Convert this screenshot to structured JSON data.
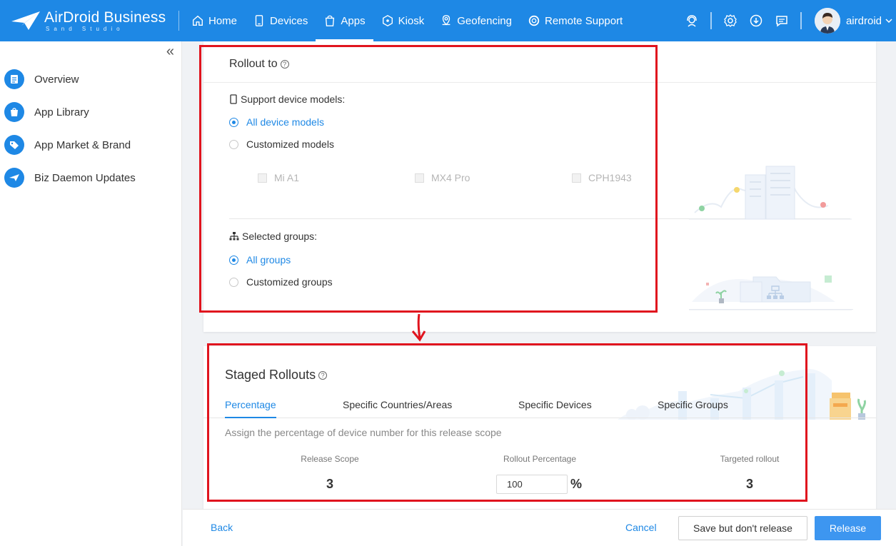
{
  "brand": {
    "name": "AirDroid Business",
    "tagline": "Sand Studio"
  },
  "nav": {
    "items": [
      {
        "label": "Home",
        "icon": "home-icon"
      },
      {
        "label": "Devices",
        "icon": "device-icon"
      },
      {
        "label": "Apps",
        "icon": "bag-icon",
        "active": true
      },
      {
        "label": "Kiosk",
        "icon": "kiosk-icon"
      },
      {
        "label": "Geofencing",
        "icon": "geofence-icon"
      },
      {
        "label": "Remote Support",
        "icon": "lifebuoy-icon"
      }
    ]
  },
  "user": {
    "name": "airdroid"
  },
  "sidebar": {
    "items": [
      {
        "label": "Overview",
        "icon": "document-icon"
      },
      {
        "label": "App Library",
        "icon": "bag-icon"
      },
      {
        "label": "App Market & Brand",
        "icon": "tag-icon"
      },
      {
        "label": "Biz Daemon Updates",
        "icon": "plane-icon"
      }
    ]
  },
  "rollout": {
    "title": "Rollout to",
    "models_label": "Support device models:",
    "all_models": "All device models",
    "custom_models": "Customized models",
    "models": [
      "Mi A1",
      "MX4 Pro",
      "CPH1943"
    ],
    "groups_label": "Selected groups:",
    "all_groups": "All groups",
    "custom_groups": "Customized groups"
  },
  "staged": {
    "title": "Staged Rollouts",
    "tabs": [
      "Percentage",
      "Specific Countries/Areas",
      "Specific Devices",
      "Specific Groups"
    ],
    "assign_text": "Assign the percentage of device number for this release scope",
    "release_scope_label": "Release Scope",
    "release_scope_value": "3",
    "rollout_pct_label": "Rollout Percentage",
    "rollout_pct_value": "100",
    "pct_sign": "%",
    "targeted_label": "Targeted rollout",
    "targeted_value": "3"
  },
  "footer": {
    "back": "Back",
    "cancel": "Cancel",
    "save": "Save but don't release",
    "release": "Release"
  },
  "colors": {
    "primary": "#1e88e5",
    "annotation": "#e0141e"
  }
}
